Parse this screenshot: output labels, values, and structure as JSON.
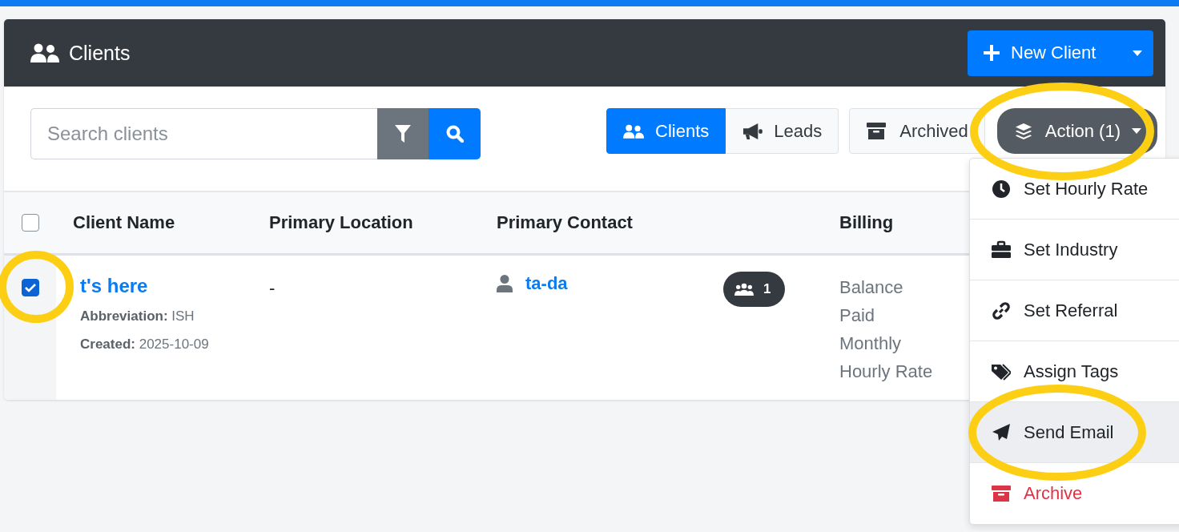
{
  "header": {
    "title": "Clients",
    "new_button": "New Client"
  },
  "search": {
    "placeholder": "Search clients"
  },
  "view_tabs": [
    {
      "label": "Clients",
      "selected": true
    },
    {
      "label": "Leads",
      "selected": false
    }
  ],
  "archived_button": "Archived",
  "action_button": "Action (1)",
  "table": {
    "select_all_checked": false,
    "columns": [
      "Client Name",
      "Primary Location",
      "Primary Contact",
      "Billing"
    ],
    "rows": [
      {
        "checked": true,
        "name": "t's here",
        "abbreviation_label": "Abbreviation:",
        "abbreviation": "ISH",
        "created_label": "Created:",
        "created": "2025-10-09",
        "location": "-",
        "contact": "ta-da",
        "contacts_count": "1",
        "billing_labels": [
          "Balance",
          "Paid",
          "Monthly",
          "Hourly Rate"
        ]
      }
    ]
  },
  "action_menu": [
    {
      "label": "Set Hourly Rate",
      "kind": "normal",
      "highlighted": false
    },
    {
      "label": "Set Industry",
      "kind": "normal",
      "highlighted": false
    },
    {
      "label": "Set Referral",
      "kind": "normal",
      "highlighted": false
    },
    {
      "label": "Assign Tags",
      "kind": "normal",
      "highlighted": false
    },
    {
      "label": "Send Email",
      "kind": "normal",
      "highlighted": true
    },
    {
      "label": "Archive",
      "kind": "danger",
      "highlighted": false
    }
  ]
}
